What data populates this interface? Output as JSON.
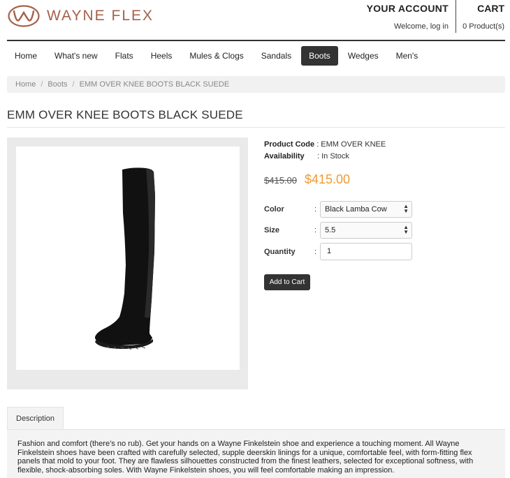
{
  "brand": {
    "name": "WAYNE FLEX",
    "color": "#a5614a"
  },
  "account": {
    "heading": "YOUR ACCOUNT",
    "welcome": "Welcome, log in"
  },
  "cart": {
    "heading": "CART",
    "count": "0 Product(s)"
  },
  "nav": {
    "items": [
      {
        "label": "Home"
      },
      {
        "label": "What's new"
      },
      {
        "label": "Flats"
      },
      {
        "label": "Heels"
      },
      {
        "label": "Mules & Clogs"
      },
      {
        "label": "Sandals"
      },
      {
        "label": "Boots",
        "active": true
      },
      {
        "label": "Wedges"
      },
      {
        "label": "Men's"
      }
    ]
  },
  "breadcrumb": [
    "Home",
    "Boots",
    "EMM OVER KNEE BOOTS BLACK SUEDE"
  ],
  "product": {
    "title": "EMM OVER KNEE BOOTS BLACK SUEDE",
    "code_label": "Product Code",
    "code": ": EMM OVER KNEE",
    "availability_label": "Availability",
    "availability": ": In Stock",
    "old_price": "$415.00",
    "price": "$415.00",
    "price_color": "#f09a32",
    "image_icon": "boot-image"
  },
  "options": {
    "color_label": "Color",
    "color_value": "Black Lamba Cow",
    "size_label": "Size",
    "size_value": "5.5",
    "quantity_label": "Quantity",
    "quantity_value": "1",
    "colon": ":"
  },
  "add_to_cart": "Add to Cart",
  "description": {
    "tab_label": "Description",
    "text": "Fashion and comfort (there’s no rub). Get your hands on a Wayne Finkelstein shoe and experience a touching moment. All Wayne Finkelstein shoes have been crafted with carefully selected, supple deerskin linings for a unique, comfortable feel, with form-fitting flex panels that mold to your foot. They are flawless silhouettes constructed from the finest leathers, selected for exceptional softness, with flexible, shock-absorbing soles. With Wayne Finkelstein shoes, you will feel comfortable making an impression."
  }
}
